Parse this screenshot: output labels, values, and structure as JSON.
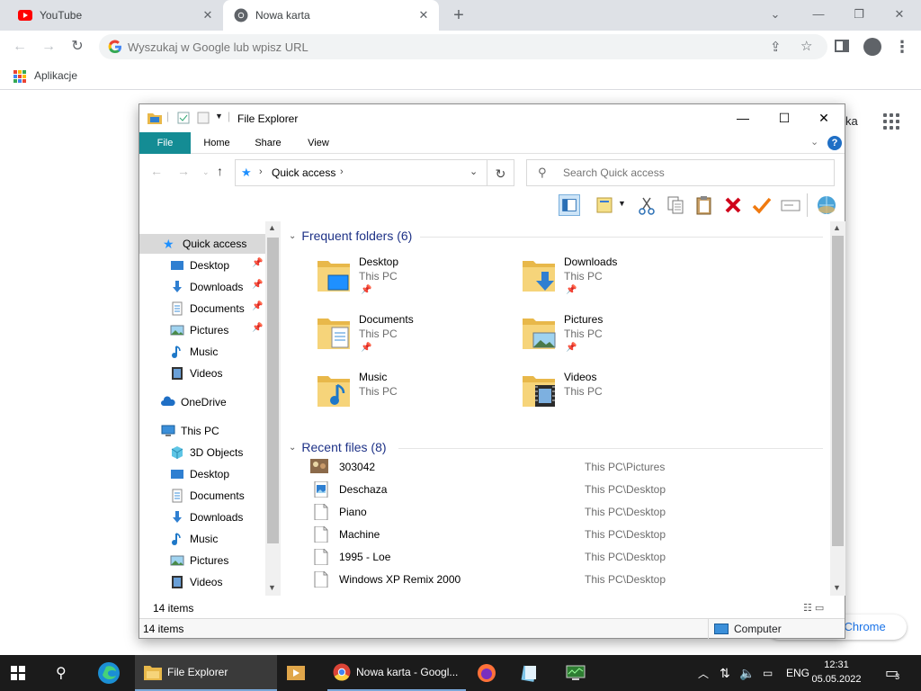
{
  "browser": {
    "tabs": [
      {
        "title": "YouTube",
        "favicon": "youtube-icon",
        "active": false
      },
      {
        "title": "Nowa karta",
        "favicon": "chrome-icon",
        "active": true
      }
    ],
    "omnibox_placeholder": "Wyszukaj w Google lub wpisz URL",
    "bookmarks_apps_label": "Aplikacje",
    "page_partial_text_right": "ka",
    "customize_button_partial": "j Chrome"
  },
  "explorer": {
    "title": "File Explorer",
    "ribbon_tabs": [
      "File",
      "Home",
      "Share",
      "View"
    ],
    "address": {
      "location": "Quick access"
    },
    "search_placeholder": "Search Quick access",
    "nav": {
      "quick_access": "Quick access",
      "pinned": [
        "Desktop",
        "Downloads",
        "Documents",
        "Pictures"
      ],
      "unpinned": [
        "Music",
        "Videos"
      ],
      "onedrive": "OneDrive",
      "this_pc": "This PC",
      "this_pc_items": [
        "3D Objects",
        "Desktop",
        "Documents",
        "Downloads",
        "Music",
        "Pictures",
        "Videos"
      ]
    },
    "frequent_header": "Frequent folders (6)",
    "frequent_folders": [
      {
        "name": "Desktop",
        "location": "This PC",
        "pinned": true
      },
      {
        "name": "Downloads",
        "location": "This PC",
        "pinned": true
      },
      {
        "name": "Documents",
        "location": "This PC",
        "pinned": true
      },
      {
        "name": "Pictures",
        "location": "This PC",
        "pinned": true
      },
      {
        "name": "Music",
        "location": "This PC",
        "pinned": false
      },
      {
        "name": "Videos",
        "location": "This PC",
        "pinned": false
      }
    ],
    "recent_header": "Recent files (8)",
    "recent_files": [
      {
        "name": "303042",
        "path": "This PC\\Pictures",
        "icon": "image-thumbnail-icon"
      },
      {
        "name": "Deschaza",
        "path": "This PC\\Desktop",
        "icon": "picture-file-icon"
      },
      {
        "name": "Piano",
        "path": "This PC\\Desktop",
        "icon": "blank-file-icon"
      },
      {
        "name": "Machine",
        "path": "This PC\\Desktop",
        "icon": "blank-file-icon"
      },
      {
        "name": "1995 - Loe",
        "path": "This PC\\Desktop",
        "icon": "blank-file-icon"
      },
      {
        "name": "Windows XP Remix 2000",
        "path": "This PC\\Desktop",
        "icon": "blank-file-icon"
      }
    ],
    "status_items_top": "14 items",
    "status_items_bottom": "14 items",
    "status_location": "Computer"
  },
  "taskbar": {
    "file_explorer_label": "File Explorer",
    "chrome_label": "Nowa karta - Googl...",
    "language": "ENG",
    "time": "12:31",
    "date": "05.05.2022",
    "notification_count": "3"
  },
  "colors": {
    "file_tab": "#148c94",
    "folder": "#f0c75e",
    "link_blue": "#1e3287",
    "taskbar": "#1b1b1b"
  }
}
